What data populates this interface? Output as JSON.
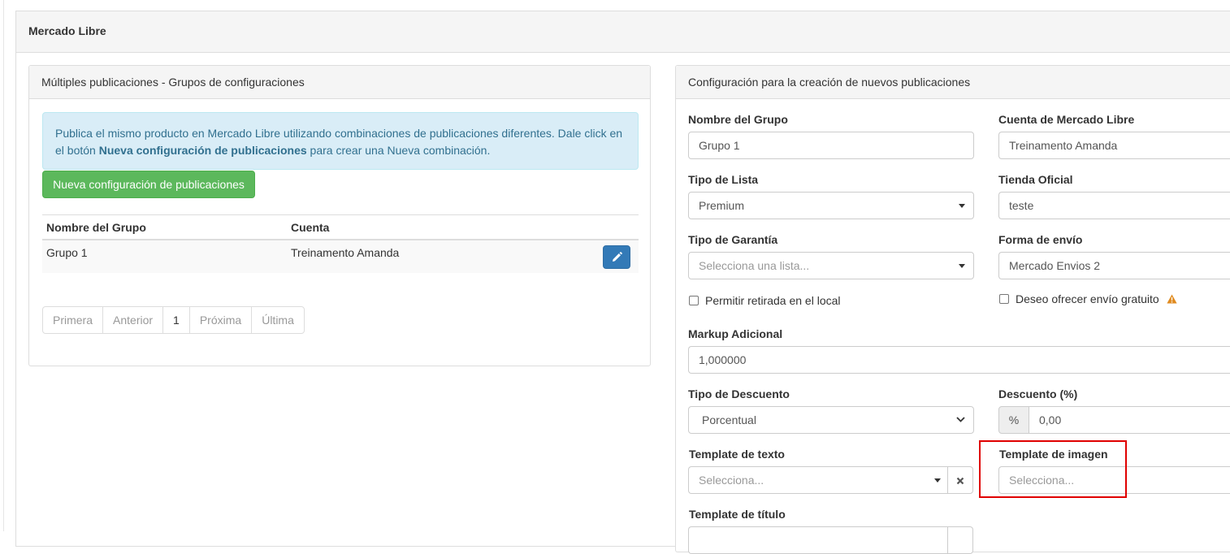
{
  "outer": {
    "title": "Mercado Libre"
  },
  "left_panel": {
    "title": "Múltiples publicaciones - Grupos de configuraciones",
    "alert": {
      "text_1": "Publica el mismo producto en Mercado Libre utilizando combinaciones de publicaciones diferentes. Dale click en el botón ",
      "bold": "Nueva configuración de publicaciones",
      "text_2": " para crear una Nueva combinación."
    },
    "new_button_label": "Nueva configuración de publicaciones",
    "table": {
      "headers": [
        "Nombre del Grupo",
        "Cuenta"
      ],
      "rows": [
        {
          "group": "Grupo 1",
          "account": "Treinamento Amanda"
        }
      ]
    },
    "pagination": [
      "Primera",
      "Anterior",
      "1",
      "Próxima",
      "Última"
    ]
  },
  "right_panel": {
    "title": "Configuración para la creación de nuevos publicaciones",
    "fields": {
      "group_name": {
        "label": "Nombre del Grupo",
        "value": "Grupo 1"
      },
      "account": {
        "label": "Cuenta de Mercado Libre",
        "value": "Treinamento Amanda"
      },
      "list_type": {
        "label": "Tipo de Lista",
        "value": "Premium"
      },
      "official_store": {
        "label": "Tienda Oficial",
        "value": "teste"
      },
      "warranty_type": {
        "label": "Tipo de Garantía",
        "placeholder": "Selecciona una lista..."
      },
      "shipping": {
        "label": "Forma de envío",
        "value": "Mercado Envios 2"
      },
      "pickup_checkbox": {
        "label": "Permitir retirada en el local"
      },
      "free_shipping_checkbox": {
        "label": "Deseo ofrecer envío gratuito"
      },
      "markup": {
        "label": "Markup Adicional",
        "value": "1,000000"
      },
      "discount_type": {
        "label": "Tipo de Descuento",
        "value": "Porcentual"
      },
      "discount": {
        "label": "Descuento (%)",
        "addon": "%",
        "value": "0,00"
      },
      "text_template": {
        "label": "Template de texto",
        "placeholder": "Selecciona..."
      },
      "image_template": {
        "label": "Template de imagen",
        "placeholder": "Selecciona..."
      },
      "title_template": {
        "label": "Template de título"
      }
    }
  },
  "colors": {
    "success": "#5cb85c",
    "primary": "#337ab7",
    "info_bg": "#d9edf7",
    "highlight": "#e00000",
    "warning": "#e08a1e"
  }
}
